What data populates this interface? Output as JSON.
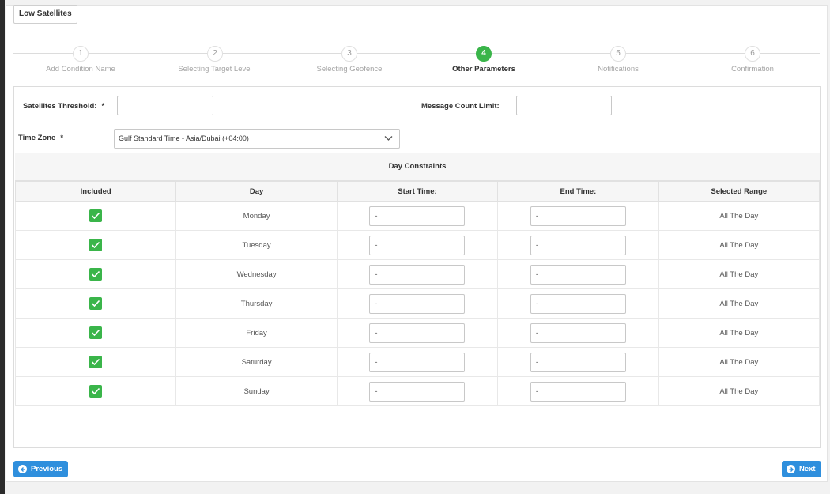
{
  "card_title": "Low Satellites",
  "steps": [
    {
      "number": "1",
      "label": "Add Condition Name",
      "active": false
    },
    {
      "number": "2",
      "label": "Selecting Target Level",
      "active": false
    },
    {
      "number": "3",
      "label": "Selecting Geofence",
      "active": false
    },
    {
      "number": "4",
      "label": "Other Parameters",
      "active": true
    },
    {
      "number": "5",
      "label": "Notifications",
      "active": false
    },
    {
      "number": "6",
      "label": "Confirmation",
      "active": false
    }
  ],
  "form": {
    "satellites_threshold_label": "Satellites Threshold:",
    "required_marker": "*",
    "satellites_threshold_value": "",
    "message_count_limit_label": "Message Count Limit:",
    "message_count_limit_value": "",
    "time_zone_label": "Time Zone",
    "time_zone_value": "Gulf Standard Time - Asia/Dubai (+04:00)"
  },
  "day_constraints": {
    "title": "Day Constraints",
    "columns": [
      "Included",
      "Day",
      "Start Time:",
      "End Time:",
      "Selected Range"
    ],
    "rows": [
      {
        "included": true,
        "day": "Monday",
        "start": "-",
        "end": "-",
        "range": "All The Day"
      },
      {
        "included": true,
        "day": "Tuesday",
        "start": "-",
        "end": "-",
        "range": "All The Day"
      },
      {
        "included": true,
        "day": "Wednesday",
        "start": "-",
        "end": "-",
        "range": "All The Day"
      },
      {
        "included": true,
        "day": "Thursday",
        "start": "-",
        "end": "-",
        "range": "All The Day"
      },
      {
        "included": true,
        "day": "Friday",
        "start": "-",
        "end": "-",
        "range": "All The Day"
      },
      {
        "included": true,
        "day": "Saturday",
        "start": "-",
        "end": "-",
        "range": "All The Day"
      },
      {
        "included": true,
        "day": "Sunday",
        "start": "-",
        "end": "-",
        "range": "All The Day"
      }
    ]
  },
  "buttons": {
    "previous": "Previous",
    "next": "Next"
  },
  "colors": {
    "accent_green": "#3ab54a",
    "button_blue": "#2f8fdd"
  },
  "icons": {
    "checkbox": "check-icon",
    "select": "chevron-down-icon",
    "previous": "arrow-left-circle-icon",
    "next": "arrow-right-circle-icon"
  }
}
